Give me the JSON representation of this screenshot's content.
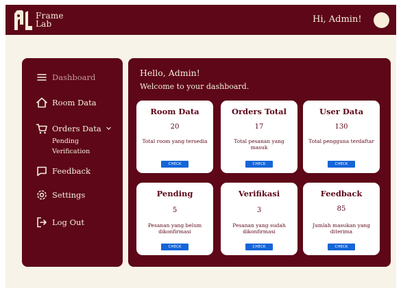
{
  "header": {
    "logo_line1": "Frame",
    "logo_line2": "Lab",
    "greeting": "Hi, Admin!"
  },
  "sidebar": {
    "items": [
      {
        "label": "Dashboard",
        "icon": "menu-icon"
      },
      {
        "label": "Room Data",
        "icon": "home-icon"
      },
      {
        "label": "Orders Data",
        "icon": "cart-icon"
      },
      {
        "label": "Feedback",
        "icon": "chat-icon"
      },
      {
        "label": "Settings",
        "icon": "gear-icon"
      },
      {
        "label": "Log Out",
        "icon": "logout-icon"
      }
    ],
    "sub_item": "Pending Verification"
  },
  "main": {
    "hello": "Hello, Admin!",
    "welcome": "Welcome to your dashboard.",
    "cards": [
      {
        "title": "Room Data",
        "value": "20",
        "desc": "Total room yang tersedia",
        "button": "CHECK"
      },
      {
        "title": "Orders Total",
        "value": "17",
        "desc": "Total pesanan yang masuk",
        "button": "CHECK"
      },
      {
        "title": "User Data",
        "value": "130",
        "desc": "Total pengguna terdaftar",
        "button": "CHECK"
      },
      {
        "title": "Pending",
        "value": "5",
        "desc": "Pesanan yang belum dikonfirmasi",
        "button": "CHECK"
      },
      {
        "title": "Verifikasi",
        "value": "3",
        "desc": "Pesanan yang sudah dikonfirmasi",
        "button": "CHECK"
      },
      {
        "title": "Feedback",
        "value": "85",
        "desc": "Jumlah masukan yang diterima",
        "button": "CHECK"
      }
    ]
  },
  "colors": {
    "primary": "#5d0718",
    "background": "#f8f3e8",
    "button": "#1565d8",
    "text_light": "#f6eedd"
  }
}
